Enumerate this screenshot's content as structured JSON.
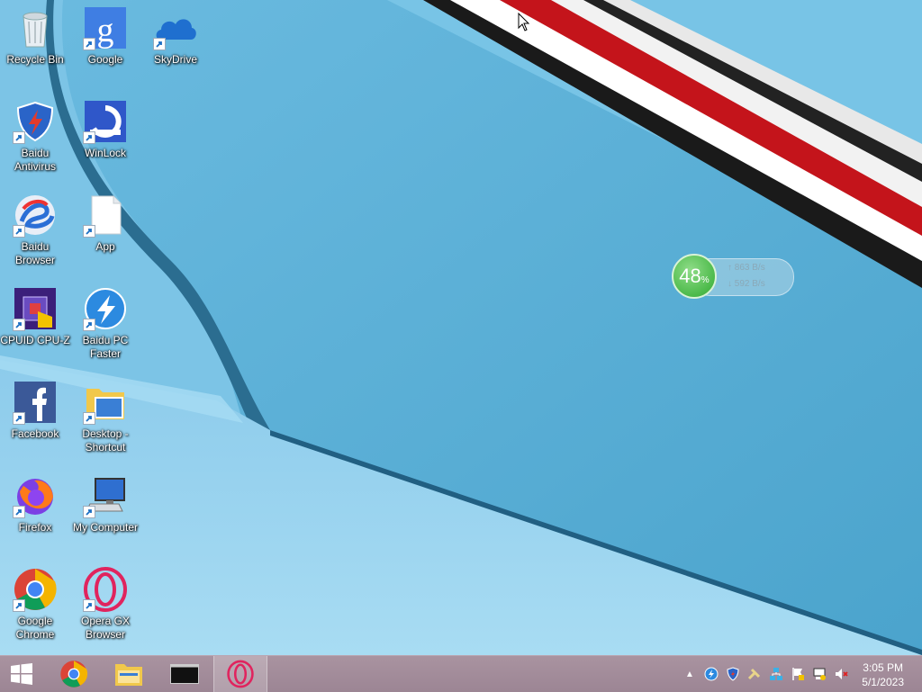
{
  "desktop_icons": [
    {
      "label": "Recycle Bin",
      "icon": "recycle-bin-icon"
    },
    {
      "label": "Google",
      "icon": "google-icon"
    },
    {
      "label": "SkyDrive",
      "icon": "skydrive-icon"
    },
    {
      "label": "Baidu Antivirus",
      "icon": "baidu-antivirus-icon"
    },
    {
      "label": "WinLock",
      "icon": "winlock-icon"
    },
    {
      "label": "Baidu Browser",
      "icon": "baidu-browser-icon"
    },
    {
      "label": "App",
      "icon": "file-icon"
    },
    {
      "label": "CPUID CPU-Z",
      "icon": "cpu-z-icon"
    },
    {
      "label": "Baidu PC Faster",
      "icon": "baidu-pc-faster-icon"
    },
    {
      "label": "Facebook",
      "icon": "facebook-icon"
    },
    {
      "label": "Desktop - Shortcut",
      "icon": "desktop-folder-icon"
    },
    {
      "label": "Firefox",
      "icon": "firefox-icon"
    },
    {
      "label": "My Computer",
      "icon": "computer-icon"
    },
    {
      "label": "Google Chrome",
      "icon": "chrome-icon"
    },
    {
      "label": "Opera GX Browser",
      "icon": "opera-icon"
    }
  ],
  "network_widget": {
    "percent": "48",
    "percent_sign": "%",
    "upload_rate": "863 B/s",
    "download_rate": "592 B/s"
  },
  "taskbar": {
    "buttons": [
      "start-button",
      "chrome",
      "file-explorer",
      "command-prompt",
      "opera"
    ],
    "clock_time": "3:05 PM",
    "clock_date": "5/1/2023"
  },
  "colors": {
    "wallpaper": "#4fa7cf",
    "taskbar": "#a993a0",
    "accent_red": "#c4141b"
  }
}
